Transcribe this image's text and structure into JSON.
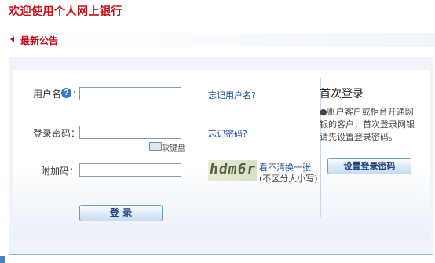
{
  "header": {
    "title": "欢迎使用个人网上银行"
  },
  "notice": {
    "label": "最新公告"
  },
  "login_form": {
    "username_label": "用户名",
    "username_colon": "：",
    "username_help_icon": "question-icon",
    "username_value": "",
    "forgot_username": "忘记用户名?",
    "password_label": "登录密码：",
    "password_value": "",
    "forgot_password": "忘记密码?",
    "soft_keyboard": "软键盘",
    "captcha_label": "附加码：",
    "captcha_value": "",
    "captcha_image_text": "hdm6r",
    "captcha_refresh": "看不清换一张",
    "captcha_hint": "(不区分大小写)",
    "login_button": "登  录"
  },
  "first_login": {
    "title": "首次登录",
    "description": "●账户客户或柜台开通网银的客户，首次登录网银请先设置登录密码。",
    "button": "设置登录密码"
  },
  "colors": {
    "brand_red": "#c0101a",
    "link_blue": "#1a4a8f",
    "panel_border": "#8fb6d8"
  }
}
